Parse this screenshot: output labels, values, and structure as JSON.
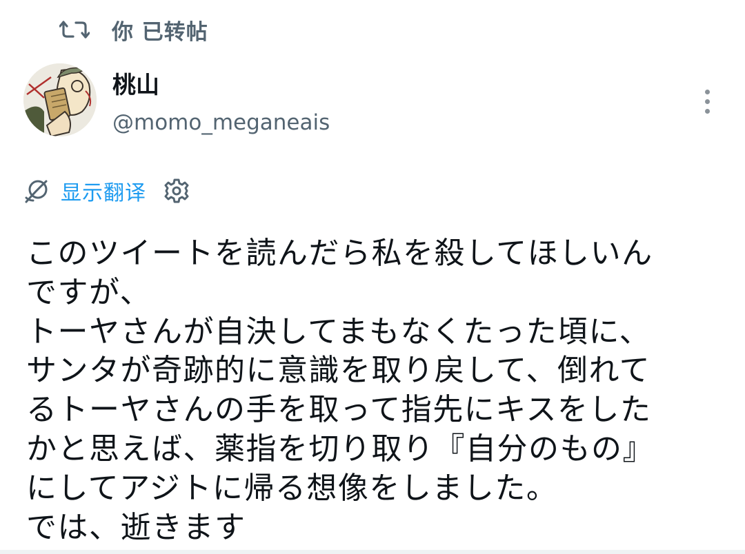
{
  "retweet": {
    "label": "你 已转帖",
    "icon": "retweet-icon"
  },
  "author": {
    "display_name": "桃山",
    "handle": "@momo_meganeais",
    "avatar": "avatar"
  },
  "more_icon": "more-vertical-icon",
  "translate": {
    "label": "显示翻译",
    "icon": "translate-icon",
    "settings_icon": "gear-icon"
  },
  "tweet": {
    "text": "このツイートを読んだら私を殺してほしいん\nですが、\nトーヤさんが自決してまもなくたった頃に、\nサンタが奇跡的に意識を取り戻して、倒れて\nるトーヤさんの手を取って指先にキスをした\nかと思えば、薬指を切り取り『自分のもの』\nにしてアジトに帰る想像をしました。\nでは、逝きます"
  },
  "colors": {
    "accent": "#1d9bf0",
    "secondary_text": "#536471",
    "primary_text": "#0f1419"
  }
}
